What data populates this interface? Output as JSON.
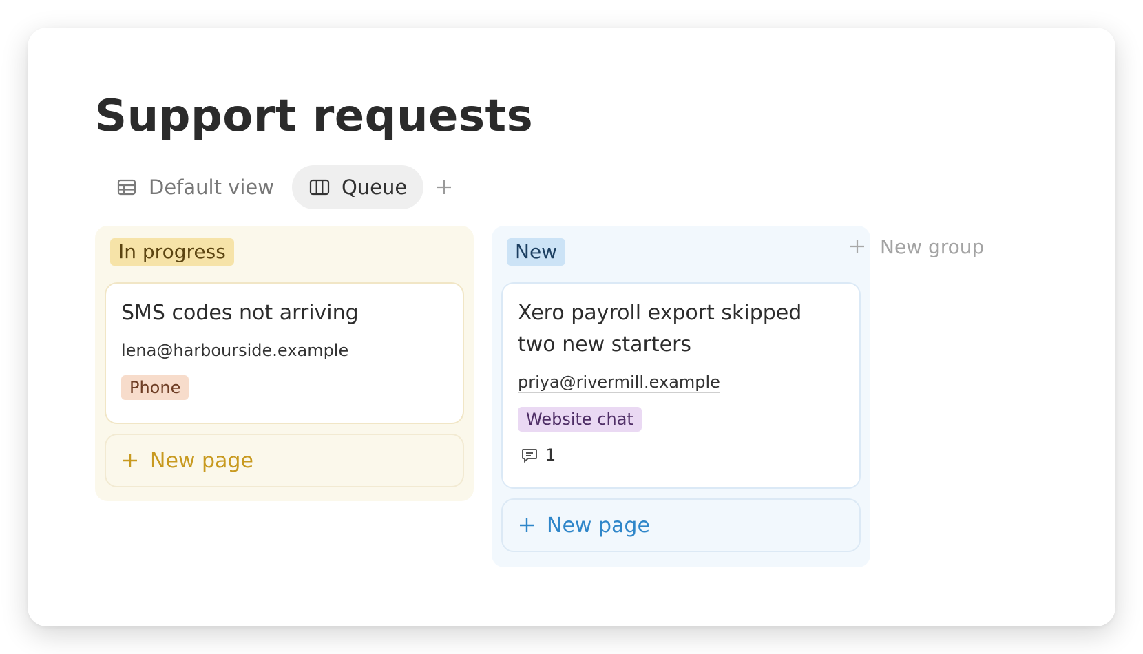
{
  "page": {
    "title": "Support requests"
  },
  "views": {
    "tabs": [
      {
        "label": "Default view",
        "icon": "table-icon",
        "active": false
      },
      {
        "label": "Queue",
        "icon": "board-icon",
        "active": true
      }
    ],
    "add_icon": "plus-icon"
  },
  "groups": [
    {
      "label": "In progress",
      "color": "#f6e3a8",
      "cards": [
        {
          "title": "SMS codes not arriving",
          "email": "lena@harbourside.example",
          "channel": "Phone",
          "channel_color": "#f7dccb"
        }
      ],
      "new_page_label": "New page"
    },
    {
      "label": "New",
      "color": "#cce3f6",
      "cards": [
        {
          "title": "Xero payroll export skipped two new starters",
          "email": "priya@rivermill.example",
          "channel": "Website chat",
          "channel_color": "#ead9f3",
          "comment_count": "1"
        }
      ],
      "new_page_label": "New page"
    }
  ],
  "new_group_label": "New group"
}
